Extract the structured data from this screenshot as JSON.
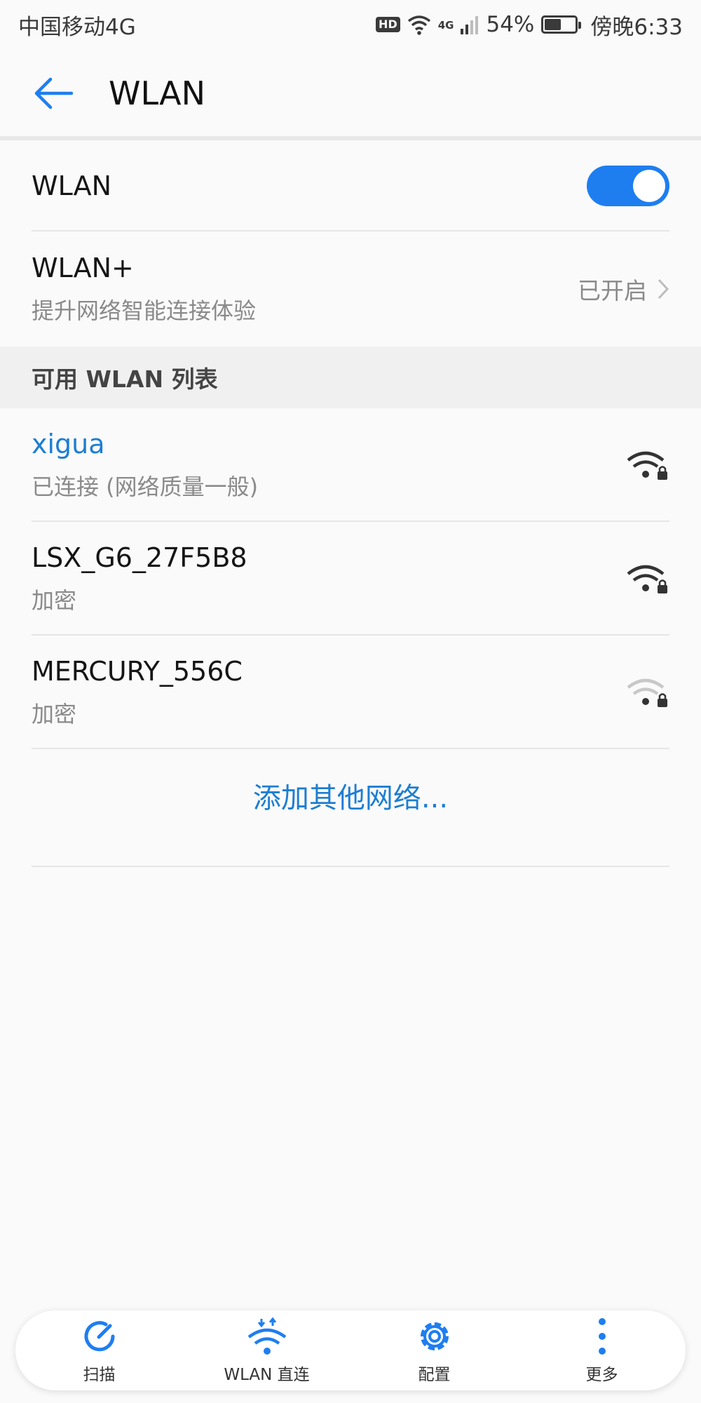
{
  "status_bar": {
    "carrier": "中国移动4G",
    "hd": "HD",
    "network_type": "4G",
    "battery_percent": "54%",
    "battery_level": 0.54,
    "time": "傍晚6:33"
  },
  "app_bar": {
    "title": "WLAN"
  },
  "wlan_toggle": {
    "label": "WLAN",
    "enabled": true
  },
  "wlan_plus": {
    "title": "WLAN+",
    "subtitle": "提升网络智能连接体验",
    "status": "已开启"
  },
  "section": {
    "header": "可用 WLAN 列表"
  },
  "networks": [
    {
      "ssid": "xigua",
      "status": "已连接 (网络质量一般)",
      "signal_level": 3,
      "secured": true,
      "connected": true
    },
    {
      "ssid": "LSX_G6_27F5B8",
      "status": "加密",
      "signal_level": 3,
      "secured": true,
      "connected": false
    },
    {
      "ssid": "MERCURY_556C",
      "status": "加密",
      "signal_level": 1,
      "secured": true,
      "connected": false
    }
  ],
  "add_network": {
    "label": "添加其他网络..."
  },
  "bottom_nav": {
    "scan": "扫描",
    "wifi_direct": "WLAN 直连",
    "config": "配置",
    "more": "更多"
  },
  "colors": {
    "accent": "#1e7ef0",
    "link": "#1e7ed2"
  },
  "icons": {
    "back": "arrow-left-icon",
    "wifi_signal": "wifi-signal-lock-icon",
    "scan": "refresh-icon",
    "wifi_direct": "wifi-direct-icon",
    "config": "gear-icon",
    "more": "more-vertical-icon"
  }
}
